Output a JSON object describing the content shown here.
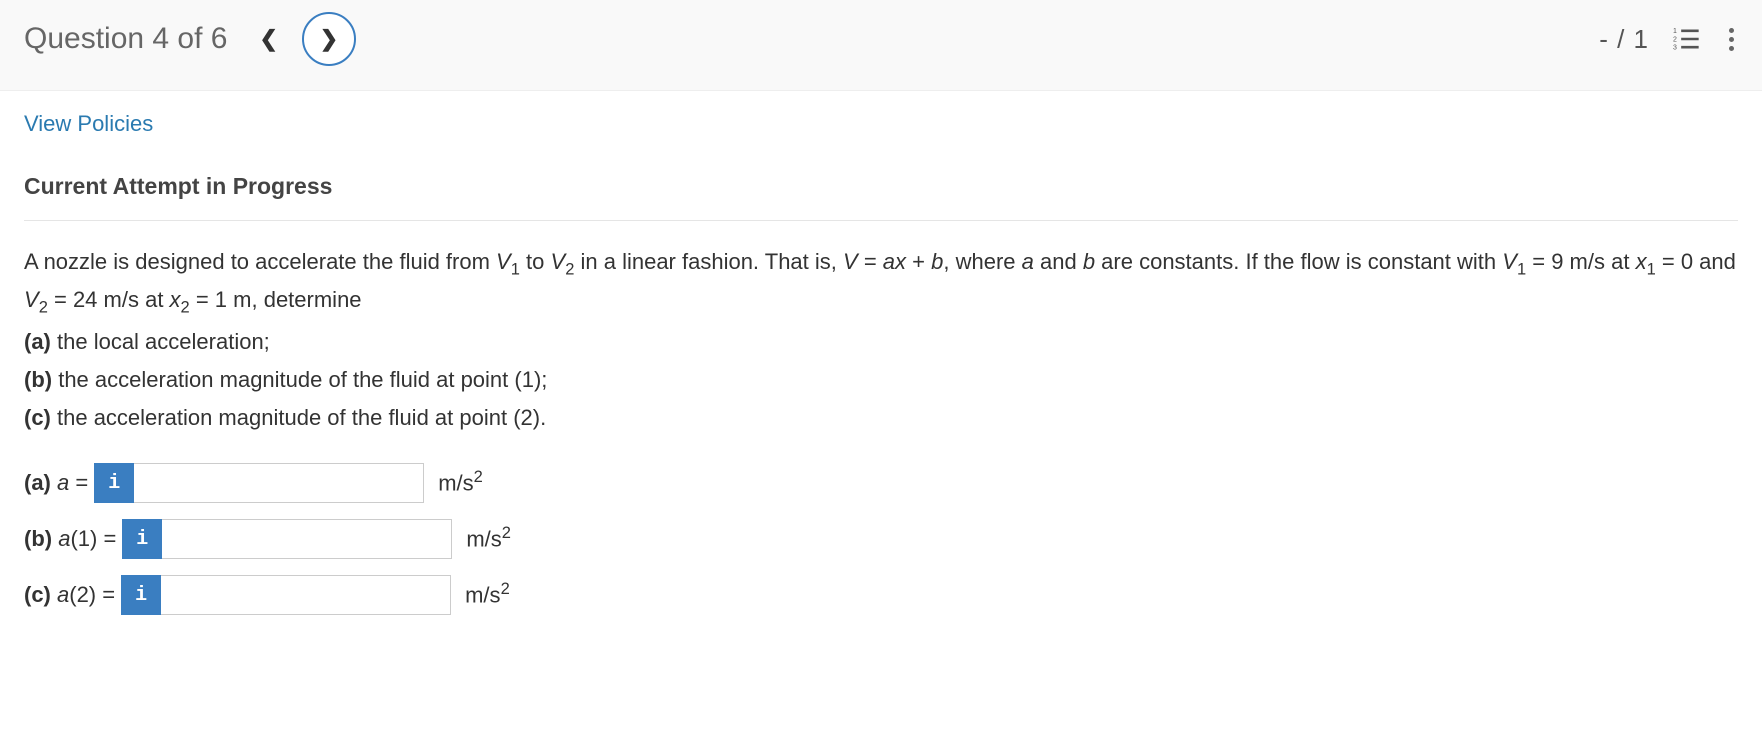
{
  "header": {
    "question_label": "Question 4 of 6",
    "score": "- / 1"
  },
  "links": {
    "policies": "View Policies"
  },
  "section": {
    "attempt_title": "Current Attempt in Progress"
  },
  "question": {
    "intro_part1": "A nozzle is designed to accelerate the fluid from ",
    "v1": "V",
    "sub1": "1",
    "intro_part2": " to ",
    "v2": "V",
    "sub2": "2",
    "intro_part3": " in a linear fashion. That is, ",
    "eq_v": "V",
    "eq_eq": " = ",
    "eq_a": "ax",
    "eq_plus": " + ",
    "eq_b": "b",
    "intro_part4": ", where ",
    "a_const": "a",
    "intro_part5": " and ",
    "b_const": "b",
    "intro_part6": " are constants. If the flow is constant with ",
    "cond_v1": "V",
    "cond_sub1": "1",
    "cond_eq1": " = 9 m/s at ",
    "cond_x1": "x",
    "cond_xsub1": "1",
    "cond_val1": " = 0 and ",
    "cond_v2": "V",
    "cond_sub2": "2",
    "cond_eq2": " = 24 m/s at ",
    "cond_x2": "x",
    "cond_xsub2": "2",
    "cond_val2": " = 1 m, determine",
    "part_a_prefix": "(a)",
    "part_a": " the local acceleration;",
    "part_b_prefix": "(b)",
    "part_b": " the acceleration magnitude of the fluid at point (1);",
    "part_c_prefix": "(c)",
    "part_c": " the acceleration magnitude of the fluid at point (2)."
  },
  "answers": {
    "a": {
      "label_prefix": "(a) ",
      "label_var": "a",
      "label_suffix": " = ",
      "unit_base": "m/s",
      "unit_exp": "2",
      "value": ""
    },
    "b": {
      "label_prefix": "(b) ",
      "label_var": "a",
      "label_arg": "(1) = ",
      "unit_base": "m/s",
      "unit_exp": "2",
      "value": ""
    },
    "c": {
      "label_prefix": "(c) ",
      "label_var": "a",
      "label_arg": "(2) = ",
      "unit_base": "m/s",
      "unit_exp": "2",
      "value": ""
    }
  },
  "icons": {
    "info": "i"
  }
}
